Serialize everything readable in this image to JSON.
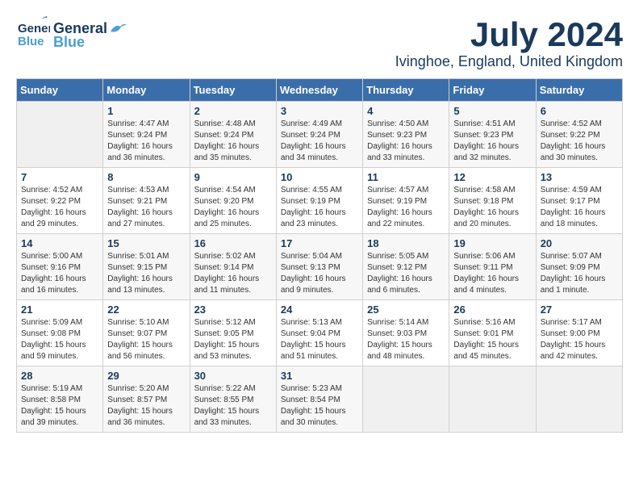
{
  "header": {
    "logo_general": "General",
    "logo_blue": "Blue",
    "month_year": "July 2024",
    "location": "Ivinghoe, England, United Kingdom"
  },
  "weekdays": [
    "Sunday",
    "Monday",
    "Tuesday",
    "Wednesday",
    "Thursday",
    "Friday",
    "Saturday"
  ],
  "weeks": [
    [
      {
        "day": "",
        "info": ""
      },
      {
        "day": "1",
        "info": "Sunrise: 4:47 AM\nSunset: 9:24 PM\nDaylight: 16 hours\nand 36 minutes."
      },
      {
        "day": "2",
        "info": "Sunrise: 4:48 AM\nSunset: 9:24 PM\nDaylight: 16 hours\nand 35 minutes."
      },
      {
        "day": "3",
        "info": "Sunrise: 4:49 AM\nSunset: 9:24 PM\nDaylight: 16 hours\nand 34 minutes."
      },
      {
        "day": "4",
        "info": "Sunrise: 4:50 AM\nSunset: 9:23 PM\nDaylight: 16 hours\nand 33 minutes."
      },
      {
        "day": "5",
        "info": "Sunrise: 4:51 AM\nSunset: 9:23 PM\nDaylight: 16 hours\nand 32 minutes."
      },
      {
        "day": "6",
        "info": "Sunrise: 4:52 AM\nSunset: 9:22 PM\nDaylight: 16 hours\nand 30 minutes."
      }
    ],
    [
      {
        "day": "7",
        "info": "Sunrise: 4:52 AM\nSunset: 9:22 PM\nDaylight: 16 hours\nand 29 minutes."
      },
      {
        "day": "8",
        "info": "Sunrise: 4:53 AM\nSunset: 9:21 PM\nDaylight: 16 hours\nand 27 minutes."
      },
      {
        "day": "9",
        "info": "Sunrise: 4:54 AM\nSunset: 9:20 PM\nDaylight: 16 hours\nand 25 minutes."
      },
      {
        "day": "10",
        "info": "Sunrise: 4:55 AM\nSunset: 9:19 PM\nDaylight: 16 hours\nand 23 minutes."
      },
      {
        "day": "11",
        "info": "Sunrise: 4:57 AM\nSunset: 9:19 PM\nDaylight: 16 hours\nand 22 minutes."
      },
      {
        "day": "12",
        "info": "Sunrise: 4:58 AM\nSunset: 9:18 PM\nDaylight: 16 hours\nand 20 minutes."
      },
      {
        "day": "13",
        "info": "Sunrise: 4:59 AM\nSunset: 9:17 PM\nDaylight: 16 hours\nand 18 minutes."
      }
    ],
    [
      {
        "day": "14",
        "info": "Sunrise: 5:00 AM\nSunset: 9:16 PM\nDaylight: 16 hours\nand 16 minutes."
      },
      {
        "day": "15",
        "info": "Sunrise: 5:01 AM\nSunset: 9:15 PM\nDaylight: 16 hours\nand 13 minutes."
      },
      {
        "day": "16",
        "info": "Sunrise: 5:02 AM\nSunset: 9:14 PM\nDaylight: 16 hours\nand 11 minutes."
      },
      {
        "day": "17",
        "info": "Sunrise: 5:04 AM\nSunset: 9:13 PM\nDaylight: 16 hours\nand 9 minutes."
      },
      {
        "day": "18",
        "info": "Sunrise: 5:05 AM\nSunset: 9:12 PM\nDaylight: 16 hours\nand 6 minutes."
      },
      {
        "day": "19",
        "info": "Sunrise: 5:06 AM\nSunset: 9:11 PM\nDaylight: 16 hours\nand 4 minutes."
      },
      {
        "day": "20",
        "info": "Sunrise: 5:07 AM\nSunset: 9:09 PM\nDaylight: 16 hours\nand 1 minute."
      }
    ],
    [
      {
        "day": "21",
        "info": "Sunrise: 5:09 AM\nSunset: 9:08 PM\nDaylight: 15 hours\nand 59 minutes."
      },
      {
        "day": "22",
        "info": "Sunrise: 5:10 AM\nSunset: 9:07 PM\nDaylight: 15 hours\nand 56 minutes."
      },
      {
        "day": "23",
        "info": "Sunrise: 5:12 AM\nSunset: 9:05 PM\nDaylight: 15 hours\nand 53 minutes."
      },
      {
        "day": "24",
        "info": "Sunrise: 5:13 AM\nSunset: 9:04 PM\nDaylight: 15 hours\nand 51 minutes."
      },
      {
        "day": "25",
        "info": "Sunrise: 5:14 AM\nSunset: 9:03 PM\nDaylight: 15 hours\nand 48 minutes."
      },
      {
        "day": "26",
        "info": "Sunrise: 5:16 AM\nSunset: 9:01 PM\nDaylight: 15 hours\nand 45 minutes."
      },
      {
        "day": "27",
        "info": "Sunrise: 5:17 AM\nSunset: 9:00 PM\nDaylight: 15 hours\nand 42 minutes."
      }
    ],
    [
      {
        "day": "28",
        "info": "Sunrise: 5:19 AM\nSunset: 8:58 PM\nDaylight: 15 hours\nand 39 minutes."
      },
      {
        "day": "29",
        "info": "Sunrise: 5:20 AM\nSunset: 8:57 PM\nDaylight: 15 hours\nand 36 minutes."
      },
      {
        "day": "30",
        "info": "Sunrise: 5:22 AM\nSunset: 8:55 PM\nDaylight: 15 hours\nand 33 minutes."
      },
      {
        "day": "31",
        "info": "Sunrise: 5:23 AM\nSunset: 8:54 PM\nDaylight: 15 hours\nand 30 minutes."
      },
      {
        "day": "",
        "info": ""
      },
      {
        "day": "",
        "info": ""
      },
      {
        "day": "",
        "info": ""
      }
    ]
  ]
}
